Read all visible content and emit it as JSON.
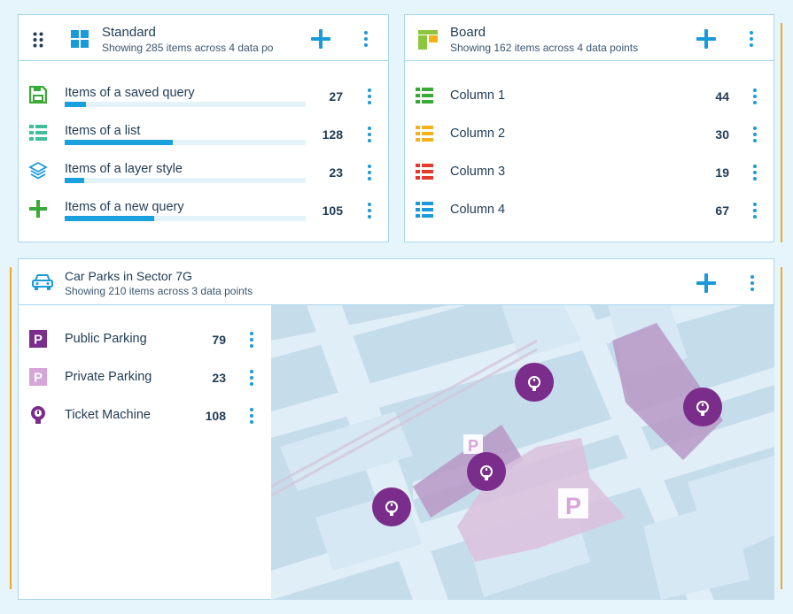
{
  "standard": {
    "title": "Standard",
    "subtitle": "Showing 285 items across 4 data po",
    "rows": [
      {
        "label": "Items of a saved query",
        "count": "27",
        "icon": "save-icon",
        "fraction": 0.09
      },
      {
        "label": "Items of a list",
        "count": "128",
        "icon": "list-icon",
        "fraction": 0.45
      },
      {
        "label": "Items of a layer style",
        "count": "23",
        "icon": "layers-icon",
        "fraction": 0.08
      },
      {
        "label": "Items of a new query",
        "count": "105",
        "icon": "plus-icon",
        "fraction": 0.37
      }
    ]
  },
  "board": {
    "title": "Board",
    "subtitle": "Showing 162 items across 4 data points",
    "rows": [
      {
        "label": "Column 1",
        "count": "44",
        "icon": "list-icon",
        "color": "#3aa935"
      },
      {
        "label": "Column 2",
        "count": "30",
        "icon": "list-icon",
        "color": "#f2b21b"
      },
      {
        "label": "Column 3",
        "count": "19",
        "icon": "list-icon",
        "color": "#e23b2e"
      },
      {
        "label": "Column 4",
        "count": "67",
        "icon": "list-icon",
        "color": "#1a9ad9"
      }
    ]
  },
  "carparks": {
    "title": "Car Parks in Sector 7G",
    "subtitle": "Showing 210 items across 3 data points",
    "rows": [
      {
        "label": "Public Parking",
        "count": "79",
        "icon": "parking-icon",
        "color": "#7b2d8b"
      },
      {
        "label": "Private Parking",
        "count": "23",
        "icon": "parking-icon",
        "color": "#d7a6d9"
      },
      {
        "label": "Ticket Machine",
        "count": "108",
        "icon": "ticket-machine-icon",
        "color": "#7b2d8b"
      }
    ],
    "map_marker_label": "P"
  },
  "colors": {
    "accent": "#1a9ad9",
    "orange": "#f5a623",
    "purple": "#7b2d8b",
    "border": "#a9d6ec"
  }
}
